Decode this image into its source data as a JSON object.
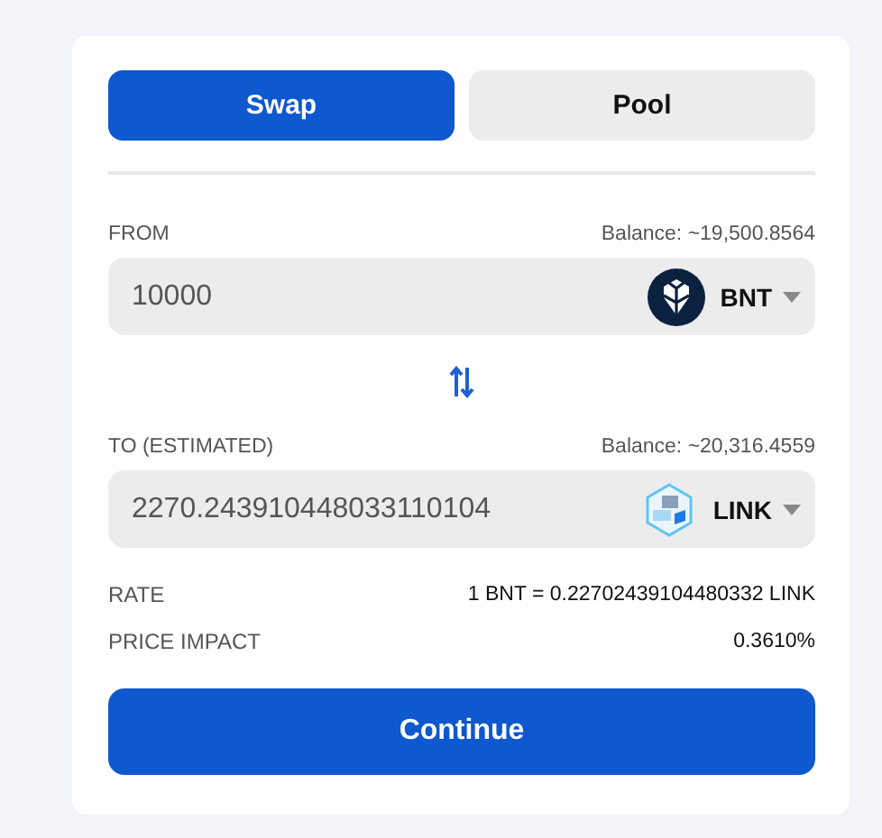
{
  "tabs": [
    {
      "label": "Swap",
      "selected": true
    },
    {
      "label": "Pool",
      "selected": false
    }
  ],
  "from": {
    "label": "FROM",
    "balance": "Balance: ~19,500.8564",
    "value": "10000",
    "token": "BNT",
    "kind": "bnt"
  },
  "to": {
    "label": "TO (ESTIMATED)",
    "balance": "Balance: ~20,316.4559",
    "value": "2270.243910448033110104",
    "token": "LINK",
    "kind": "cube"
  },
  "details": [
    {
      "label": "RATE",
      "value": "1 BNT = 0.22702439104480332 LINK"
    },
    {
      "label": "PRICE IMPACT",
      "value": "0.3610%"
    }
  ],
  "button": "Continue"
}
